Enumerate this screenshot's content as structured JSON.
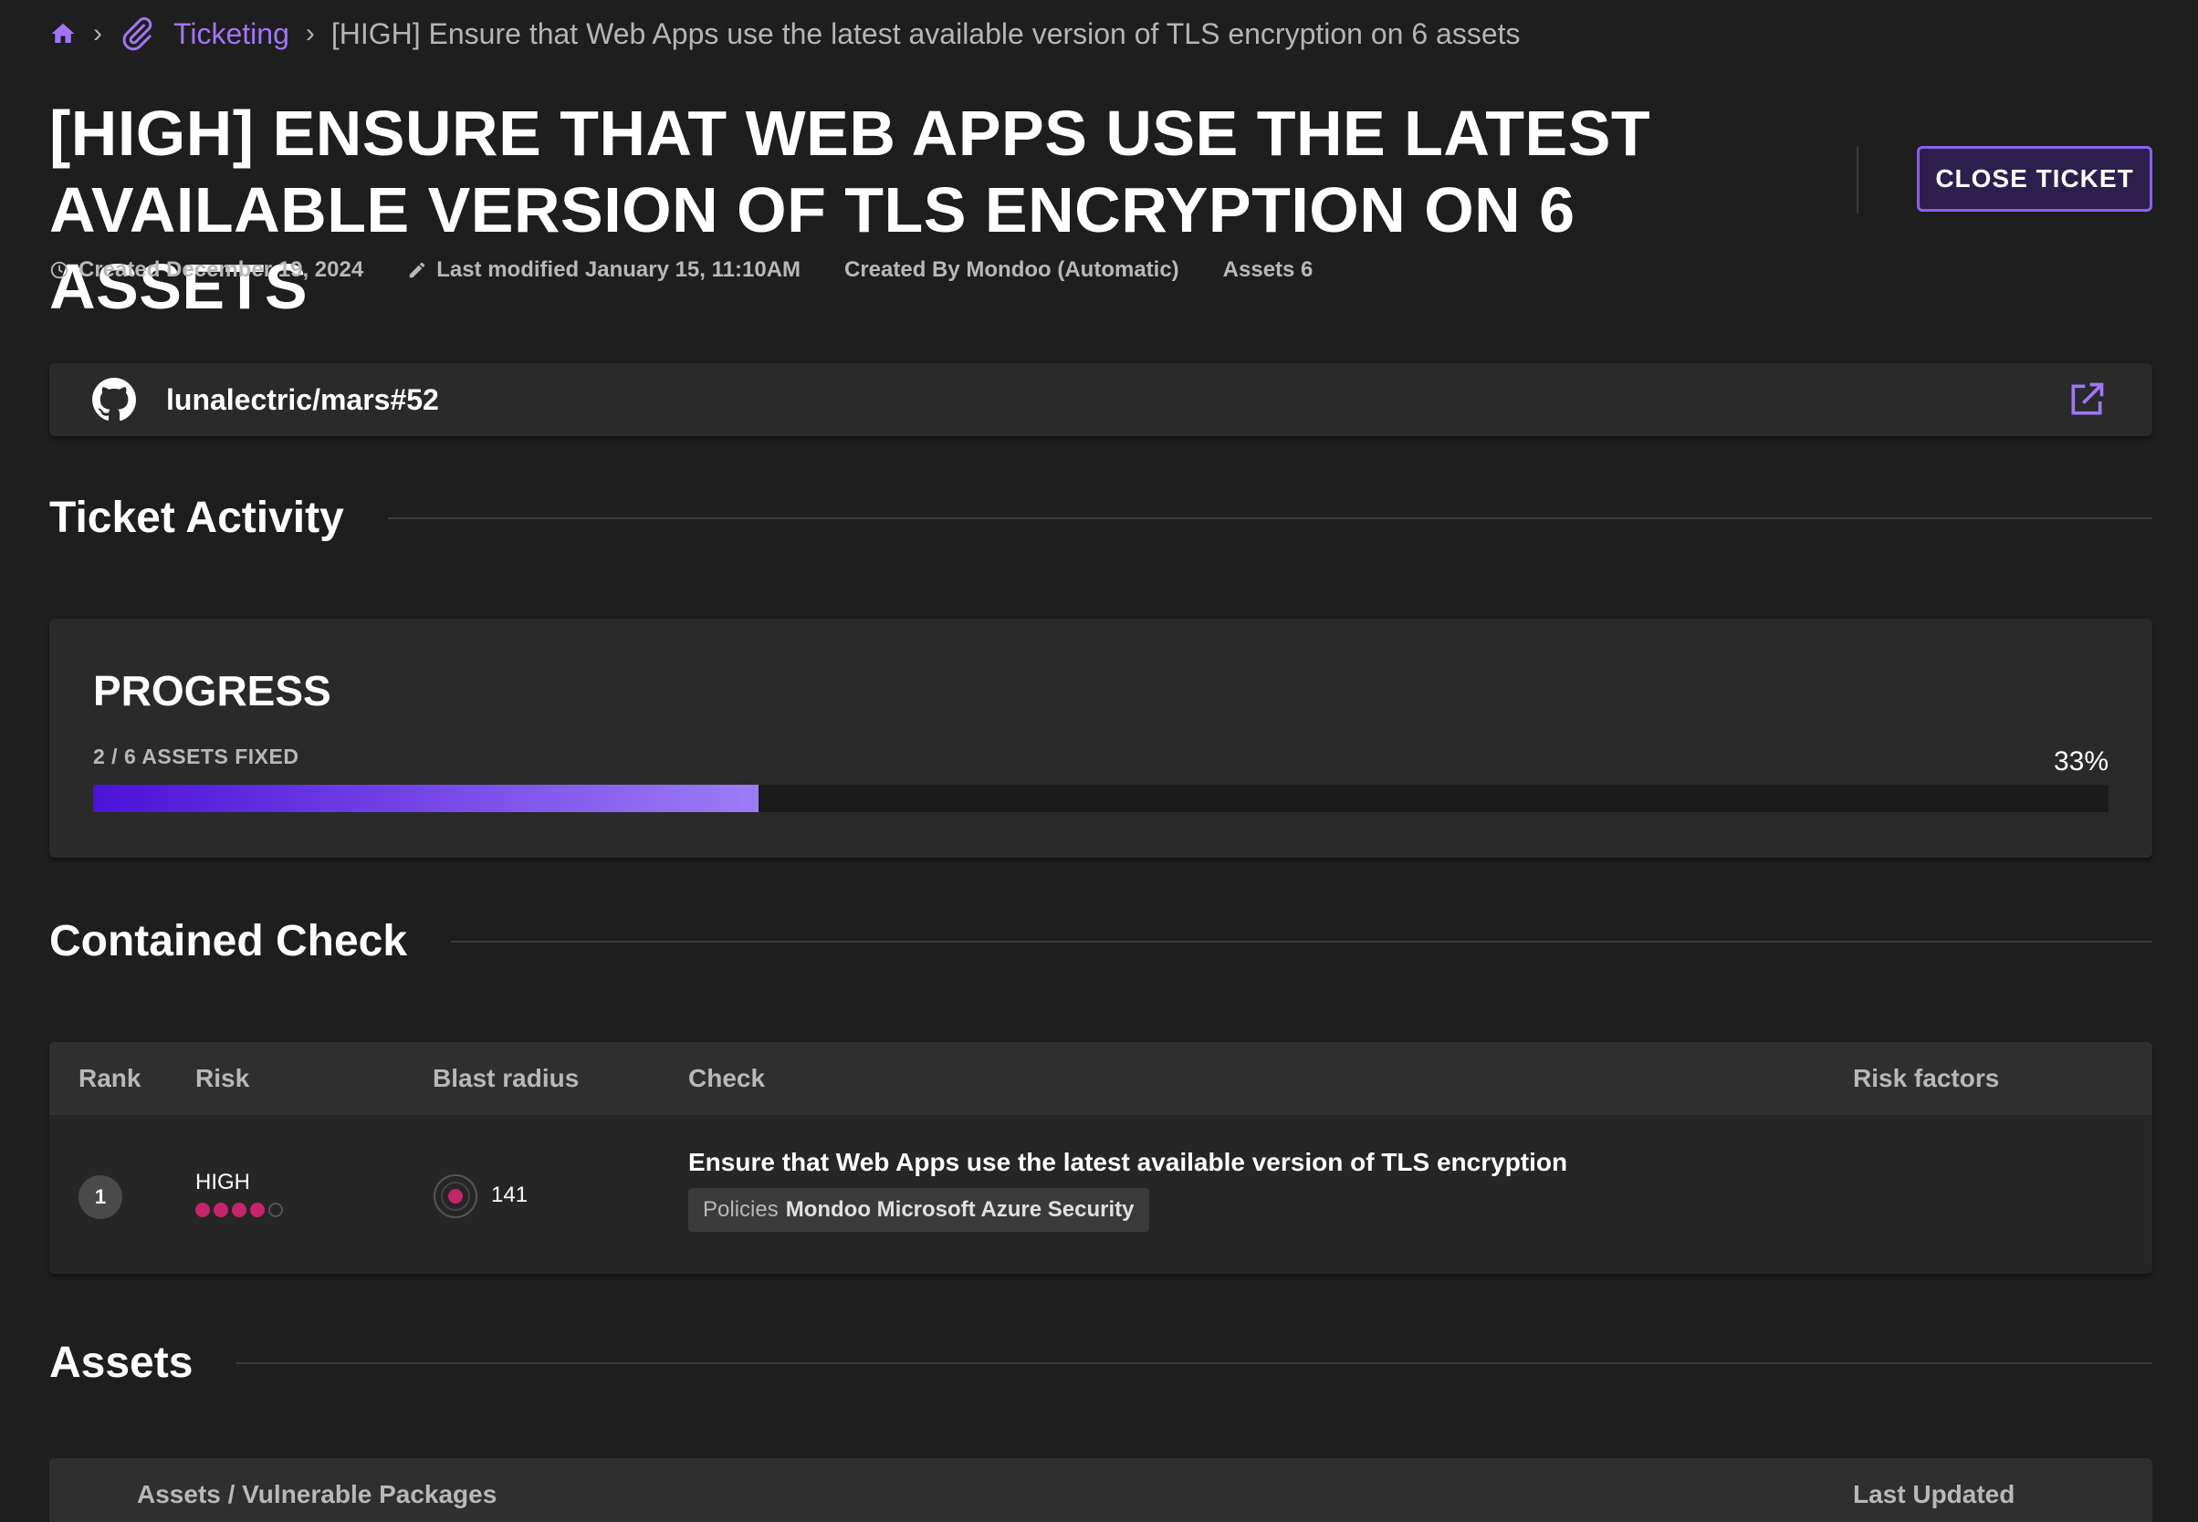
{
  "breadcrumb": {
    "home_icon": "home-icon",
    "section_icon": "paperclip-icon",
    "section": "Ticketing",
    "current": "[HIGH] Ensure that Web Apps use the latest available version of TLS encryption on 6 assets"
  },
  "header": {
    "title": "[HIGH] Ensure that Web Apps use the latest available version of TLS encryption on 6 assets",
    "close_button": "CLOSE TICKET"
  },
  "meta": {
    "created": "Created December 19, 2024",
    "modified": "Last modified January 15, 11:10AM",
    "created_by": "Created By Mondoo (Automatic)",
    "assets": "Assets 6"
  },
  "integration": {
    "icon": "github-icon",
    "label": "lunalectric/mars#52",
    "link_icon": "external-link-icon"
  },
  "ticket_activity": {
    "heading": "Ticket Activity",
    "progress": {
      "title": "PROGRESS",
      "subtitle": "2 / 6 ASSETS FIXED",
      "percent_label": "33%",
      "fixed": 2,
      "total": 6,
      "fraction": 0.33
    }
  },
  "contained_check": {
    "heading": "Contained Check",
    "columns": {
      "rank": "Rank",
      "risk": "Risk",
      "blast_radius": "Blast radius",
      "check": "Check",
      "risk_factors": "Risk factors"
    },
    "row": {
      "rank": "1",
      "risk": "HIGH",
      "risk_level": 4,
      "risk_max": 5,
      "blast_radius": "141",
      "check_title": "Ensure that Web Apps use the latest available version of TLS encryption",
      "policy_prefix": "Policies",
      "policy_name": "Mondoo Microsoft Azure Security"
    }
  },
  "assets": {
    "heading": "Assets",
    "columns": {
      "name": "Assets / Vulnerable Packages",
      "updated": "Last Updated"
    }
  },
  "colors": {
    "background": "#1e1e1e",
    "accent": "#9f77f5",
    "risk": "#c4256b",
    "card": "#2a2a2a"
  }
}
